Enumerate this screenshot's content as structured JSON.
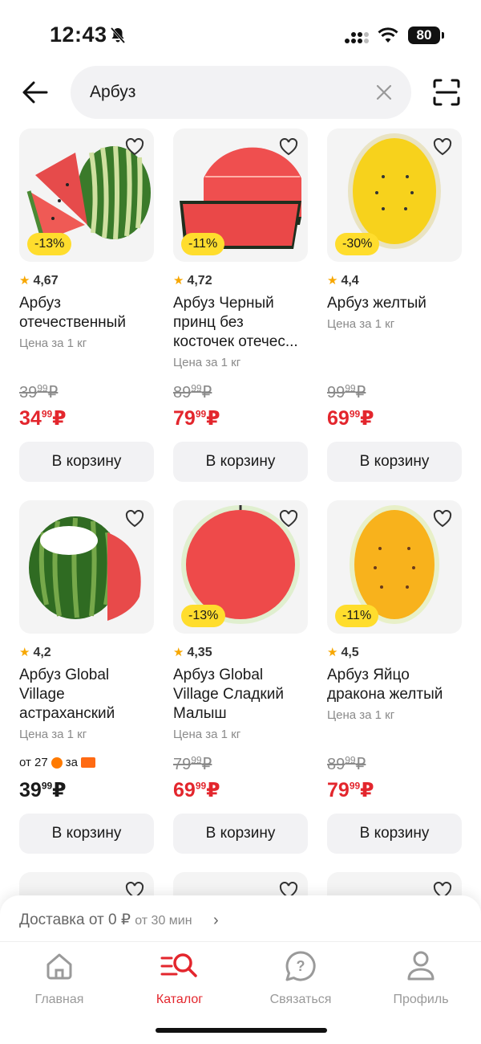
{
  "status_bar": {
    "time": "12:43",
    "battery": "80"
  },
  "search": {
    "value": "Арбуз"
  },
  "products": [
    {
      "rating": "4,67",
      "title": "Арбуз отечественный",
      "unit": "Цена за 1 кг",
      "discount": "-13%",
      "old_int": "39",
      "old_dec": "99",
      "new_int": "34",
      "new_dec": "99",
      "currency": "₽",
      "button": "В корзину"
    },
    {
      "rating": "4,72",
      "title": "Арбуз Черный принц без косточек отечес...",
      "unit": "Цена за 1 кг",
      "discount": "-11%",
      "old_int": "89",
      "old_dec": "99",
      "new_int": "79",
      "new_dec": "99",
      "currency": "₽",
      "button": "В корзину"
    },
    {
      "rating": "4,4",
      "title": "Арбуз желтый",
      "unit": "Цена за 1 кг",
      "discount": "-30%",
      "old_int": "99",
      "old_dec": "99",
      "new_int": "69",
      "new_dec": "99",
      "currency": "₽",
      "button": "В корзину"
    },
    {
      "rating": "4,2",
      "title": "Арбуз Global Village астраханский",
      "unit": "Цена за 1 кг",
      "promo": "от 27",
      "promo_mid": "за",
      "reg_int": "39",
      "reg_dec": "99",
      "currency": "₽",
      "button": "В корзину"
    },
    {
      "rating": "4,35",
      "title": "Арбуз Global Village Сладкий Малыш",
      "unit": "Цена за 1 кг",
      "discount": "-13%",
      "old_int": "79",
      "old_dec": "99",
      "new_int": "69",
      "new_dec": "99",
      "currency": "₽",
      "button": "В корзину"
    },
    {
      "rating": "4,5",
      "title": "Арбуз Яйцо дракона желтый",
      "unit": "Цена за 1 кг",
      "discount": "-11%",
      "old_int": "89",
      "old_dec": "99",
      "new_int": "79",
      "new_dec": "99",
      "currency": "₽",
      "button": "В корзину"
    }
  ],
  "delivery": {
    "main": "Доставка от 0 ₽",
    "time": "от 30 мин"
  },
  "tabs": [
    {
      "label": "Главная",
      "icon": "home-icon"
    },
    {
      "label": "Каталог",
      "icon": "catalog-search-icon"
    },
    {
      "label": "Связаться",
      "icon": "help-chat-icon"
    },
    {
      "label": "Профиль",
      "icon": "profile-icon"
    }
  ],
  "colors": {
    "accent": "#e3262d",
    "discount_badge": "#ffdd2d",
    "star": "#f7a700",
    "card_bg": "#f4f4f4"
  }
}
